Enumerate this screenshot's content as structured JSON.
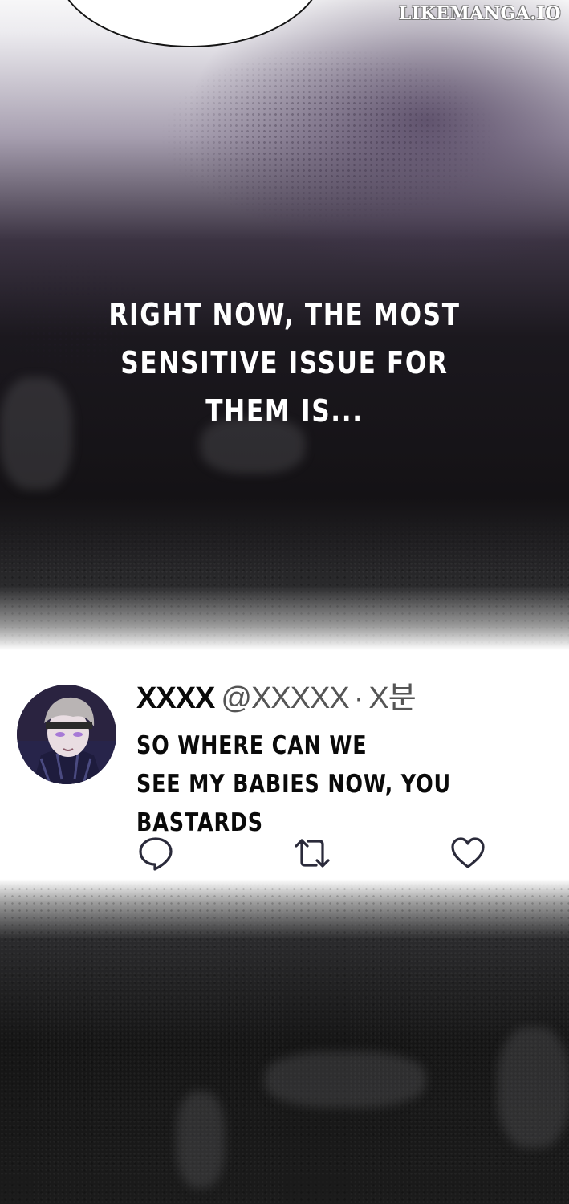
{
  "watermark": "LIKEMANGA.IO",
  "narration": {
    "lines": [
      "RIGHT NOW, THE MOST",
      "SENSITIVE ISSUE FOR",
      "THEM IS..."
    ]
  },
  "tweet": {
    "name": "XXXX",
    "handle": "@XXXXX",
    "separator": "·",
    "time": "X분",
    "body_lines": [
      "SO WHERE CAN WE",
      "SEE MY BABIES NOW, YOU",
      "BASTARDS"
    ],
    "icons": {
      "reply": "reply-icon",
      "retweet": "retweet-icon",
      "like": "heart-icon"
    }
  },
  "colors": {
    "text_dark": "#0a0a0a",
    "text_muted": "#555555",
    "narration_text": "#ffffff",
    "icon_stroke": "#2a2a3a"
  }
}
